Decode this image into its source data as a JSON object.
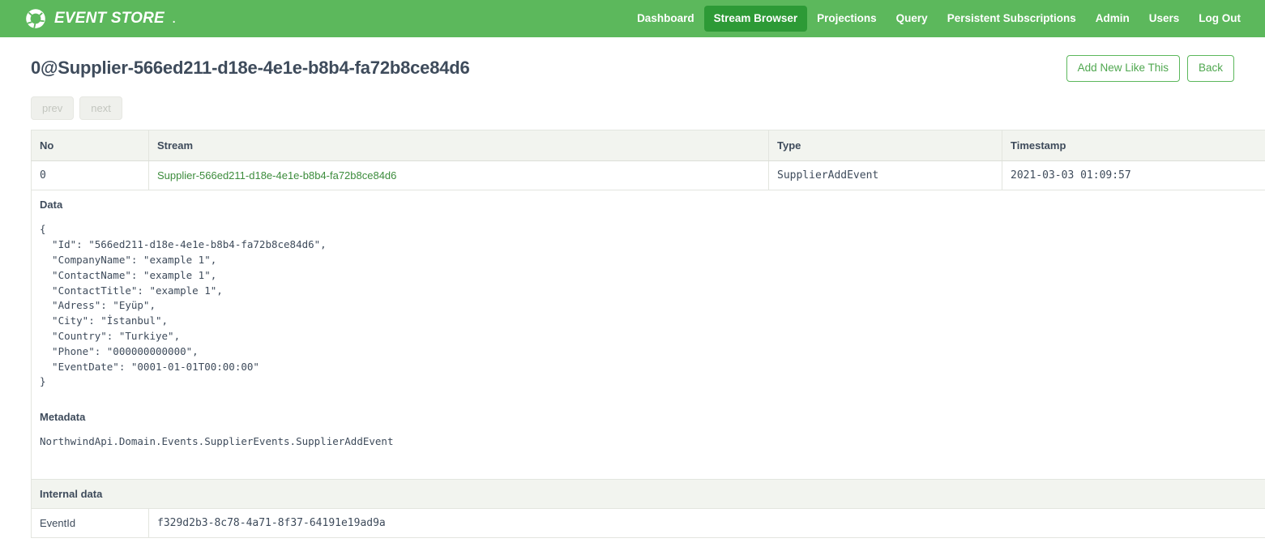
{
  "navbar": {
    "brand": "EVENT STORE",
    "brand_dot": ".",
    "logo_icon": "event-store-ring-logo",
    "items": [
      {
        "label": "Dashboard",
        "active": false
      },
      {
        "label": "Stream Browser",
        "active": true
      },
      {
        "label": "Projections",
        "active": false
      },
      {
        "label": "Query",
        "active": false
      },
      {
        "label": "Persistent Subscriptions",
        "active": false
      },
      {
        "label": "Admin",
        "active": false
      },
      {
        "label": "Users",
        "active": false
      },
      {
        "label": "Log Out",
        "active": false
      }
    ],
    "bg_color": "#5cb85c",
    "active_color": "#2d9a36"
  },
  "header": {
    "title": "0@Supplier-566ed211-d18e-4e1e-b8b4-fa72b8ce84d6",
    "add_new_label": "Add New Like This",
    "back_label": "Back"
  },
  "pager": {
    "prev_label": "prev",
    "next_label": "next"
  },
  "table": {
    "columns": [
      "No",
      "Stream",
      "Type",
      "Timestamp"
    ],
    "row": {
      "no": "0",
      "stream": "Supplier-566ed211-d18e-4e1e-b8b4-fa72b8ce84d6",
      "type": "SupplierAddEvent",
      "timestamp": "2021-03-03 01:09:57"
    }
  },
  "detail": {
    "data_label": "Data",
    "data_json": "{\n  \"Id\": \"566ed211-d18e-4e1e-b8b4-fa72b8ce84d6\",\n  \"CompanyName\": \"example 1\",\n  \"ContactName\": \"example 1\",\n  \"ContactTitle\": \"example 1\",\n  \"Adress\": \"Eyüp\",\n  \"City\": \"İstanbul\",\n  \"Country\": \"Turkiye\",\n  \"Phone\": \"000000000000\",\n  \"EventDate\": \"0001-01-01T00:00:00\"\n}",
    "metadata_label": "Metadata",
    "metadata_value": "NorthwindApi.Domain.Events.SupplierEvents.SupplierAddEvent"
  },
  "internal": {
    "section_label": "Internal data",
    "rows": [
      {
        "key": "EventId",
        "value": "f329d2b3-8c78-4a71-8f37-64191e19ad9a"
      }
    ]
  },
  "colors": {
    "brand_green": "#5cb85c",
    "active_green": "#2d9a36",
    "link_green": "#3c8c3c",
    "text": "#3e4b5b",
    "header_tint": "#f2f4ef",
    "border": "#e3e5df"
  }
}
